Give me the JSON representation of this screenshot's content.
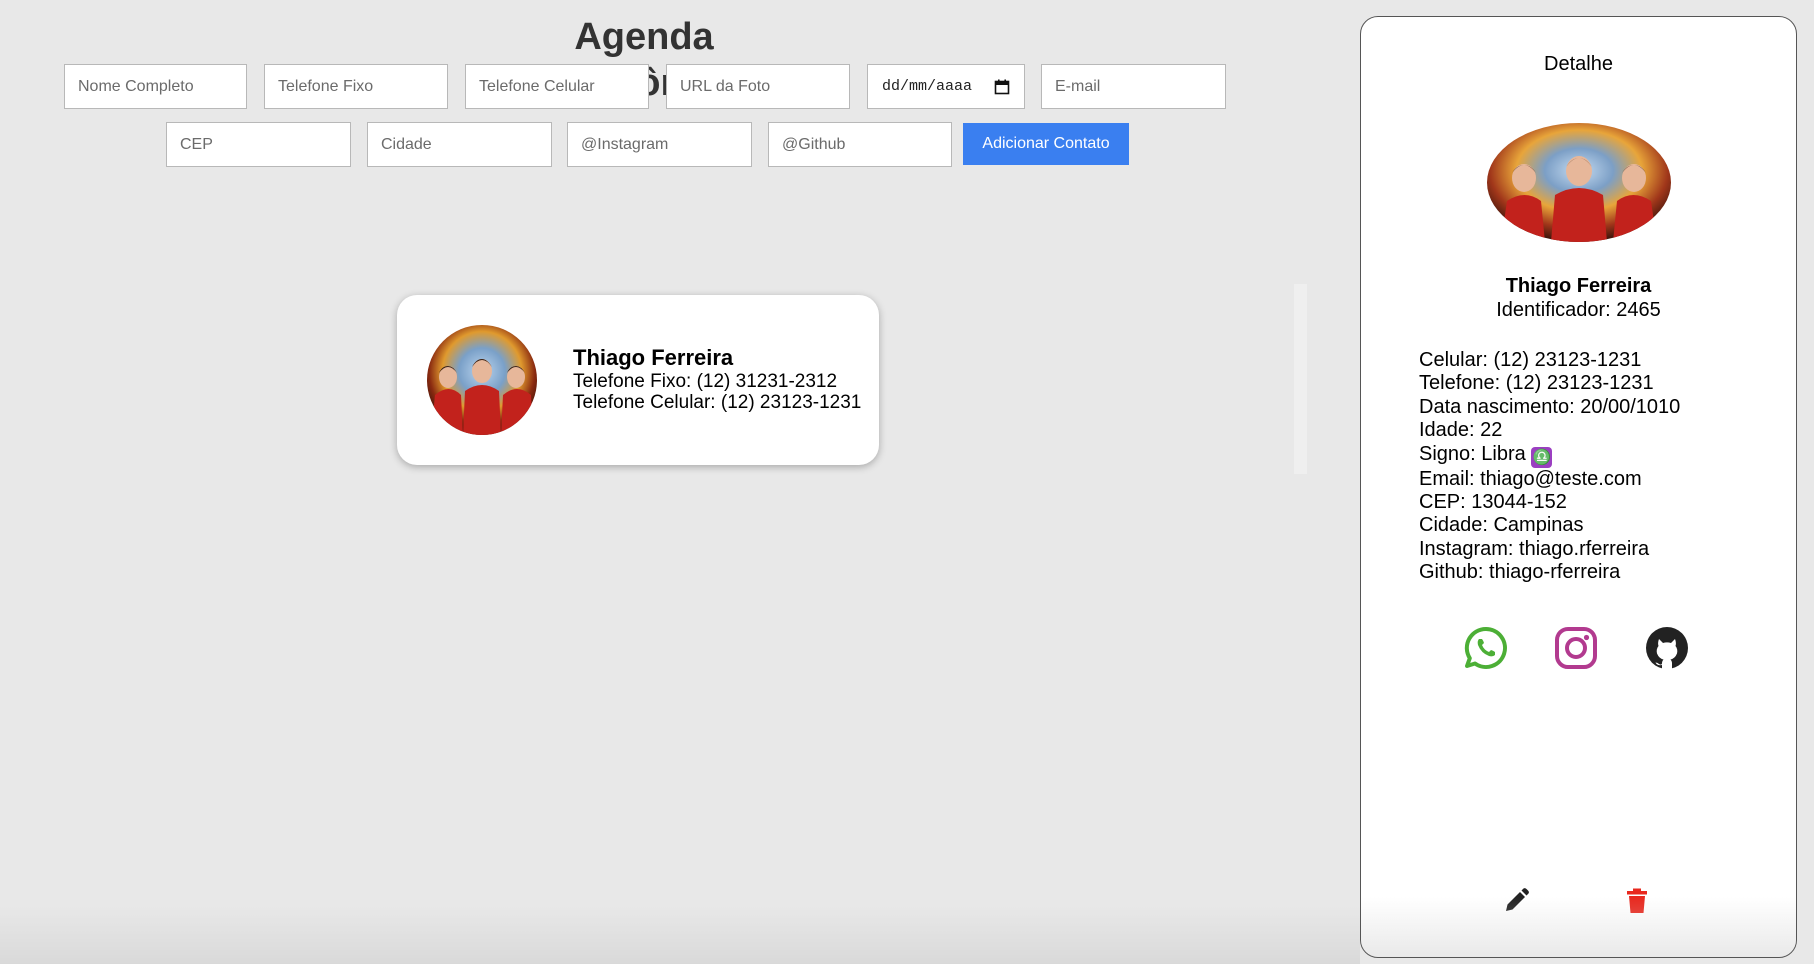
{
  "app": {
    "title": "Agenda Telefônica"
  },
  "form": {
    "nome_placeholder": "Nome Completo",
    "telefone_fixo_placeholder": "Telefone Fixo",
    "telefone_celular_placeholder": "Telefone Celular",
    "url_foto_placeholder": "URL da Foto",
    "date_placeholder": "dd/mm/aaaa",
    "email_placeholder": "E-mail",
    "cep_placeholder": "CEP",
    "cidade_placeholder": "Cidade",
    "instagram_placeholder": "@Instagram",
    "github_placeholder": "@Github",
    "add_button": "Adicionar Contato"
  },
  "contacts": [
    {
      "name": "Thiago Ferreira",
      "telefone_fixo": "Telefone Fixo: (12) 31231-2312",
      "telefone_celular": "Telefone Celular: (12) 23123-1231"
    }
  ],
  "detail": {
    "title": "Detalhe",
    "name": "Thiago Ferreira",
    "identificador": "Identificador: 2465",
    "celular": "Celular: (12) 23123-1231",
    "telefone": "Telefone: (12) 23123-1231",
    "data_nascimento": "Data nascimento: 20/00/1010",
    "idade": "Idade: 22",
    "signo": "Signo: Libra",
    "signo_symbol": "♎",
    "email": "Email: thiago@teste.com",
    "cep": "CEP: 13044-152",
    "cidade": "Cidade: Campinas",
    "instagram": "Instagram: thiago.rferreira",
    "github": "Github: thiago-rferreira"
  },
  "icons": {
    "whatsapp": "whatsapp-icon",
    "instagram": "instagram-icon",
    "github": "github-icon",
    "edit": "pencil-icon",
    "delete": "trash-icon",
    "calendar": "calendar-icon"
  },
  "colors": {
    "accent": "#3a7ff0",
    "whatsapp": "#4caf36",
    "instagram": "#b23a8f",
    "github": "#222222",
    "delete": "#e8281e",
    "zodiac": "#9b3fc1"
  }
}
